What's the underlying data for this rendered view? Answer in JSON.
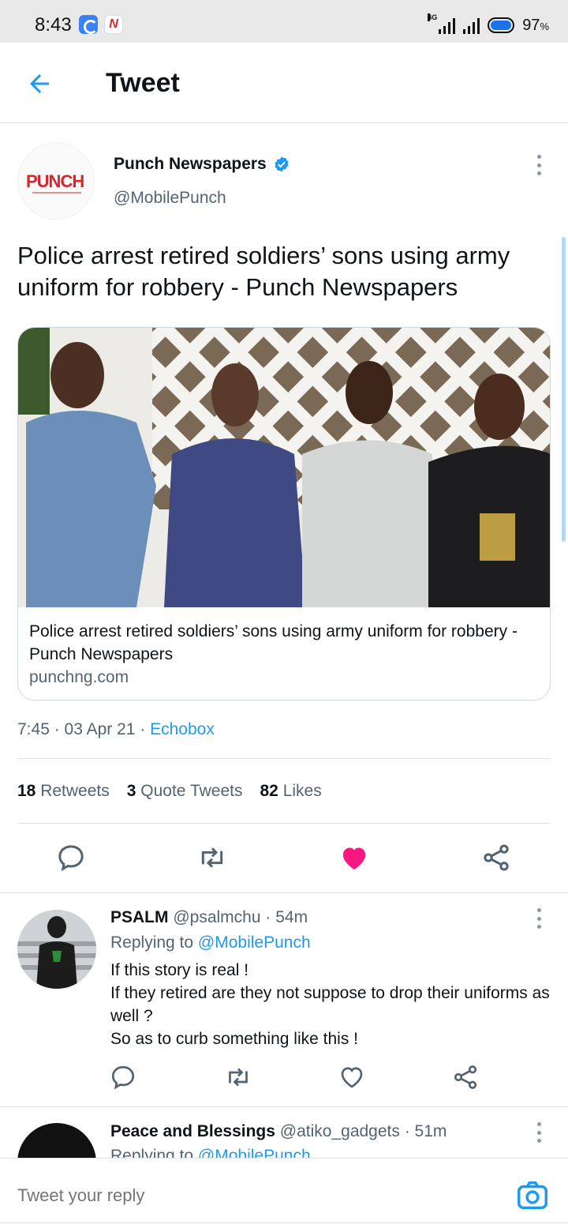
{
  "status_bar": {
    "time": "8:43",
    "network": "4G",
    "battery_percent": "97",
    "battery_unit": "%"
  },
  "header": {
    "title": "Tweet"
  },
  "tweet": {
    "author_name": "Punch Newspapers",
    "verified": true,
    "handle": "@MobilePunch",
    "avatar_logo_text": "PUNCH",
    "text": "Police arrest retired soldiers’ sons using army uniform for robbery - Punch Newspapers",
    "card": {
      "title": "Police arrest retired soldiers’ sons using army uniform for robbery - Punch Newspapers",
      "domain": "punchng.com"
    },
    "time": "7:45",
    "date": "03 Apr 21",
    "source": "Echobox",
    "stats": {
      "retweets_count": "18",
      "retweets_label": "Retweets",
      "quotes_count": "3",
      "quotes_label": "Quote Tweets",
      "likes_count": "82",
      "likes_label": "Likes"
    },
    "liked": true
  },
  "replies": [
    {
      "name": "PSALM",
      "handle": "@psalmchu",
      "time": "54m",
      "replying_prefix": "Replying to",
      "replying_to": "@MobilePunch",
      "lines": [
        "If this story is real !",
        "If they retired are they not suppose to drop their uniforms as well ?",
        "So as to curb something like this !"
      ]
    },
    {
      "name": "Peace and Blessings",
      "handle": "@atiko_gadgets",
      "time": "51m",
      "replying_prefix": "Replying to",
      "replying_to": "@MobilePunch"
    }
  ],
  "reply_bar": {
    "placeholder": "Tweet your reply"
  },
  "colors": {
    "accent": "#1d9bf0",
    "like": "#f91880",
    "secondary_text": "#536471",
    "divider": "#e1e4e6"
  }
}
